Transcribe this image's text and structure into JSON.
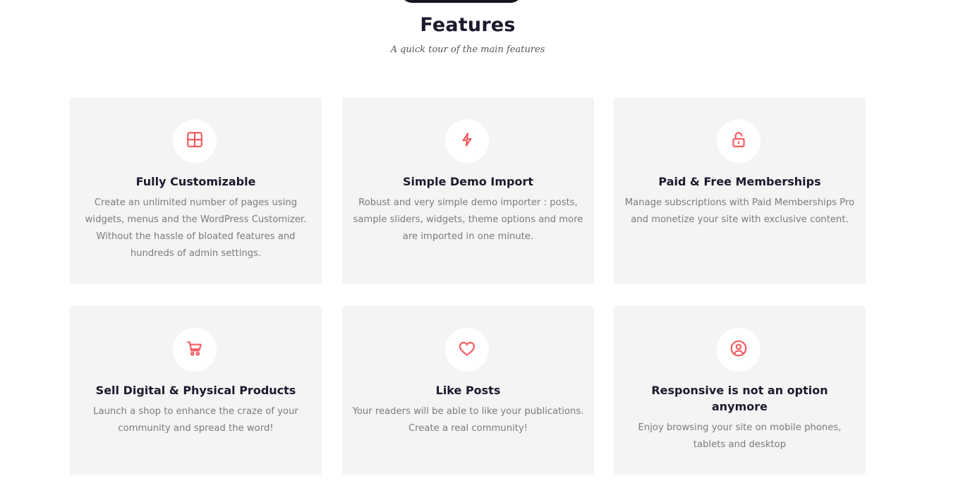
{
  "header": {
    "title": "Features",
    "subtitle": "A quick tour of the main features"
  },
  "accent_color": "#f25c5f",
  "features": [
    {
      "icon": "layout-icon",
      "title": "Fully Customizable",
      "description": "Create an unlimited number of pages using widgets, menus and the WordPress Customizer. Without the hassle of bloated features and hundreds of admin settings."
    },
    {
      "icon": "lightning-icon",
      "title": "Simple Demo Import",
      "description": "Robust and very simple demo importer : posts, sample sliders, widgets, theme options and more are imported in one minute."
    },
    {
      "icon": "unlock-icon",
      "title": "Paid & Free Memberships",
      "description": "Manage subscriptions with Paid Memberships Pro and monetize your site with exclusive content."
    },
    {
      "icon": "shopping-cart-icon",
      "title": "Sell Digital & Physical Products",
      "description": "Launch a shop to enhance the craze of your community and spread the word!"
    },
    {
      "icon": "heart-icon",
      "title": "Like Posts",
      "description": "Your readers will be able to like your publications. Create a real community!"
    },
    {
      "icon": "user-circle-icon",
      "title": "Responsive is not an option anymore",
      "description": "Enjoy browsing your site on mobile phones, tablets and desktop"
    }
  ]
}
